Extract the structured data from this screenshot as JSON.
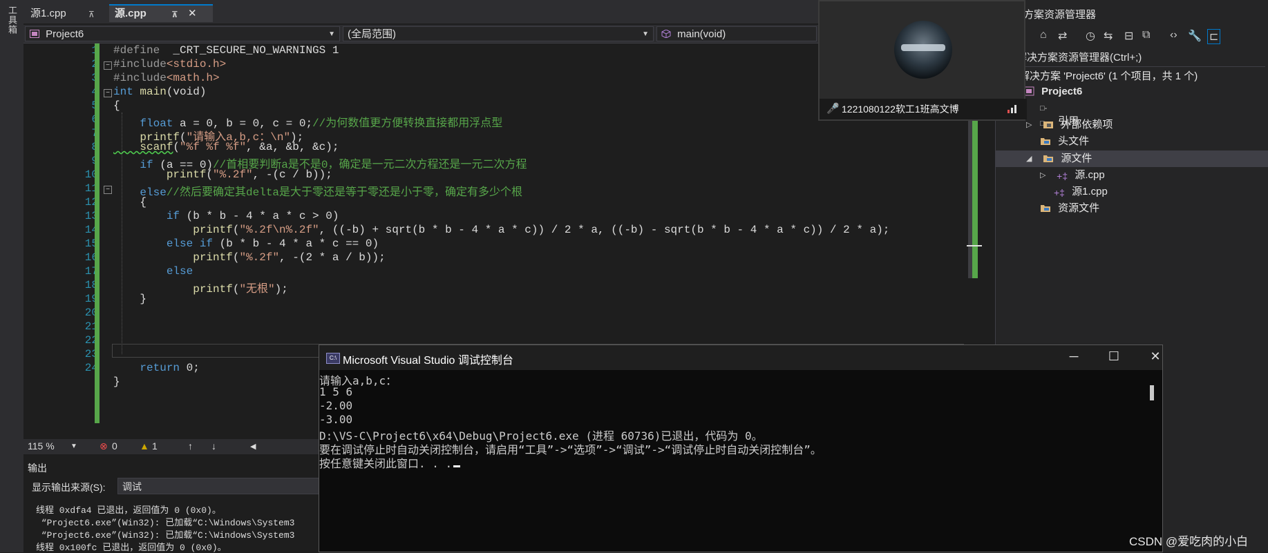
{
  "left_strip": {
    "label": "工具箱"
  },
  "tabs": [
    {
      "label": "源1.cpp",
      "pin": "⊼",
      "active": false
    },
    {
      "label": "源.cpp",
      "pin": "⊼",
      "close": "✕",
      "active": true
    }
  ],
  "navbar": {
    "project": "Project6",
    "scope": "(全局范围)",
    "member": "main(void)"
  },
  "editor": {
    "line_numbers": [
      "1",
      "2",
      "3",
      "4",
      "5",
      "6",
      "7",
      "8",
      "9",
      "10",
      "11",
      "12",
      "13",
      "14",
      "15",
      "16",
      "17",
      "18",
      "19",
      "20",
      "21",
      "22",
      "23",
      "24"
    ],
    "code": {
      "l1_a": "#define",
      "l1_b": "  _CRT_SECURE_NO_WARNINGS 1",
      "l2_a": "#include",
      "l2_b": "<stdio.h>",
      "l3_a": "#include",
      "l3_b": "<math.h>",
      "l4_kw": "int",
      "l4_fn": " main",
      "l4_rest": "(void)",
      "l5": "{",
      "l6_kw": "    float",
      "l6_code": " a = 0, b = 0, c = 0;",
      "l6_cm": "//为何数值更方便转换直接都用浮点型",
      "l7_fn": "    printf",
      "l7_p1": "(",
      "l7_st": "\"请输入a,b,c：\\n\"",
      "l7_p2": ");",
      "l8_fn": "    scanf",
      "l8_p1": "(",
      "l8_st": "\"%f %f %f\"",
      "l8_p2": ", &a, &b, &c);",
      "l9_kw": "    if",
      "l9_code": " (a == 0)",
      "l9_cm": "//首相要判断a是不是0，确定是一元二次方程还是一元二次方程",
      "l10_fn": "        printf",
      "l10_p1": "(",
      "l10_st": "\"%.2f\"",
      "l10_p2": ", -(c / b));",
      "l11_kw": "    else",
      "l11_cm": "//然后要确定其delta是大于零还是等于零还是小于零，确定有多少个根",
      "l12": "    {",
      "l13_kw": "        if",
      "l13_code": " (b * b - 4 * a * c > 0)",
      "l14_fn": "            printf",
      "l14_p1": "(",
      "l14_st": "\"%.2f\\n%.2f\"",
      "l14_p2": ", ((-b) + sqrt(b * b - 4 * a * c)) / 2 * a, ((-b) - sqrt(b * b - 4 * a * c)) / 2 * a);",
      "l15_kw": "        else if",
      "l15_code": " (b * b - 4 * a * c == 0)",
      "l16_fn": "            printf",
      "l16_p1": "(",
      "l16_st": "\"%.2f\"",
      "l16_p2": ", -(2 * a / b));",
      "l17_kw": "        else",
      "l18_fn": "            printf",
      "l18_p1": "(",
      "l18_st": "\"无根\"",
      "l18_p2": ");",
      "l19": "    }",
      "l23_kw": "    return",
      "l23_code": " 0;",
      "l24": "}"
    }
  },
  "status": {
    "zoom": "115 %",
    "errors": "0",
    "warnings": "1",
    "up": "↑",
    "down": "↓",
    "left": "◀"
  },
  "output": {
    "header": "输出",
    "source_label": "显示输出来源(S):",
    "source_value": "调试",
    "lines": [
      "线程 0xdfa4 已退出，返回值为 0 (0x0)。",
      " “Project6.exe”(Win32): 已加载“C:\\Windows\\System3",
      " “Project6.exe”(Win32): 已加载“C:\\Windows\\System3",
      "线程 0x100fc 已退出，返回值为 0 (0x0)。"
    ]
  },
  "solution_explorer": {
    "title": "方案资源管理器",
    "search": "解决方案资源管理器(Ctrl+;)",
    "items": [
      {
        "label": "解决方案 'Project6' (1 个项目，共 1 个)"
      },
      {
        "label": "Project6"
      },
      {
        "label": "引用"
      },
      {
        "label": "外部依赖项"
      },
      {
        "label": "头文件"
      },
      {
        "label": "源文件"
      },
      {
        "label": "源.cpp"
      },
      {
        "label": "源1.cpp"
      },
      {
        "label": "资源文件"
      }
    ]
  },
  "webcam": {
    "mic": "🎤",
    "name": "1221080122软工1班高文博"
  },
  "console": {
    "icon": "C:\\",
    "title": "Microsoft Visual Studio 调试控制台",
    "minimize": "─",
    "maximize": "☐",
    "close": "✕",
    "lines": [
      "请输入a,b,c：",
      "1 5 6",
      "-2.00",
      "-3.00",
      "D:\\VS-C\\Project6\\x64\\Debug\\Project6.exe (进程 60736)已退出，代码为 0。",
      "要在调试停止时自动关闭控制台，请启用“工具”->“选项”->“调试”->“调试停止时自动关闭控制台”。",
      "按任意键关闭此窗口. . ."
    ]
  },
  "watermark": "CSDN @爱吃肉的小白",
  "colors": {
    "accent": "#007acc",
    "change_bar": "#57a64a",
    "keyword": "#569cd6",
    "comment": "#57a64a",
    "string": "#d69d85"
  }
}
